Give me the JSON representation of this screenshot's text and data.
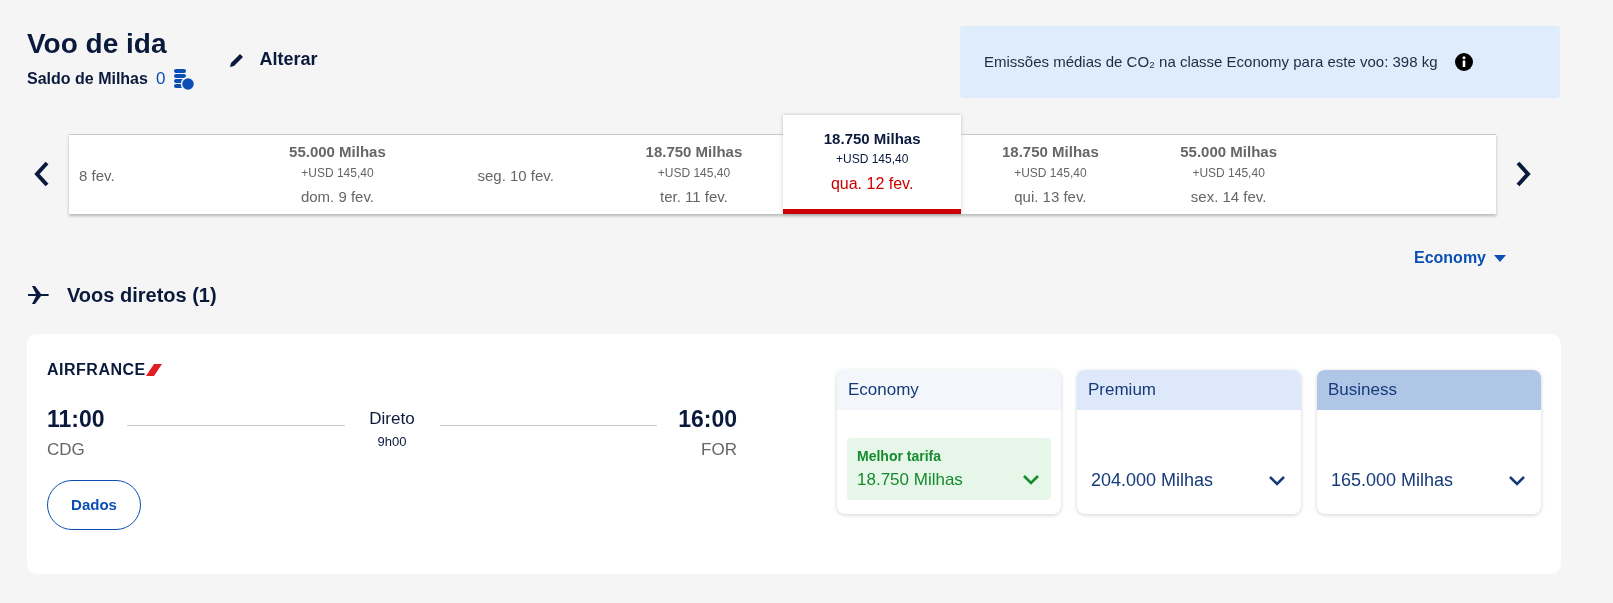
{
  "header": {
    "title": "Voo de ida",
    "balance_label": "Saldo de Milhas",
    "balance_value": "0",
    "change_link": "Alterar"
  },
  "emissions": {
    "text": "Emissões médias de CO₂ na classe Economy para este voo: 398 kg"
  },
  "dates": [
    {
      "date": "8 fev.",
      "selected": false
    },
    {
      "miles": "55.000 Milhas",
      "usd": "+USD 145,40",
      "date": "dom. 9 fev.",
      "selected": false
    },
    {
      "date": "seg. 10 fev.",
      "selected": false
    },
    {
      "miles": "18.750 Milhas",
      "usd": "+USD 145,40",
      "date": "ter. 11 fev.",
      "selected": false
    },
    {
      "miles": "18.750 Milhas",
      "usd": "+USD 145,40",
      "date": "qua. 12 fev.",
      "selected": true
    },
    {
      "miles": "18.750 Milhas",
      "usd": "+USD 145,40",
      "date": "qui. 13 fev.",
      "selected": false
    },
    {
      "miles": "55.000 Milhas",
      "usd": "+USD 145,40",
      "date": "sex. 14 fev.",
      "selected": false
    },
    {
      "selected": false
    }
  ],
  "cabin_select": "Economy",
  "section_title": "Voos diretos (1)",
  "flight": {
    "airline": "AIRFRANCE",
    "depart_time": "11:00",
    "depart_airport": "CDG",
    "stops": "Direto",
    "duration": "9h00",
    "arrive_time": "16:00",
    "arrive_airport": "FOR",
    "details_button": "Dados",
    "fares": [
      {
        "cabin": "Economy",
        "color": "#f3f7fc",
        "badge": "Melhor tarifa",
        "price": "18.750 Milhas"
      },
      {
        "cabin": "Premium",
        "color": "#dde9fb",
        "price": "204.000 Milhas"
      },
      {
        "cabin": "Business",
        "color": "#afc6e6",
        "price": "165.000 Milhas"
      }
    ]
  }
}
